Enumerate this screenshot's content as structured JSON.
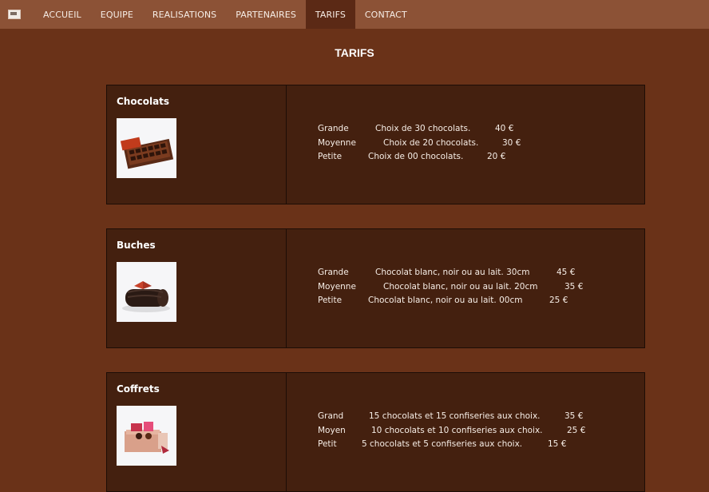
{
  "nav": {
    "items": [
      {
        "label": "ACCUEIL"
      },
      {
        "label": "EQUIPE"
      },
      {
        "label": "REALISATIONS"
      },
      {
        "label": "PARTENAIRES"
      },
      {
        "label": "TARIFS",
        "active": true
      },
      {
        "label": "CONTACT"
      }
    ]
  },
  "page": {
    "title": "TARIFS"
  },
  "sections": [
    {
      "title": "Chocolats",
      "image_icon": "chocolate-box-icon",
      "rows": [
        {
          "size": "Grande",
          "desc": "Choix de 30 chocolats.",
          "price": "40 €"
        },
        {
          "size": "Moyenne",
          "desc": "Choix de 20 chocolats.",
          "price": "30 €"
        },
        {
          "size": "Petite",
          "desc": "Choix de 00 chocolats.",
          "price": "20 €"
        }
      ]
    },
    {
      "title": "Buches",
      "image_icon": "yule-log-icon",
      "rows": [
        {
          "size": "Grande",
          "desc": "Chocolat blanc, noir ou au lait. 30cm",
          "price": "45 €"
        },
        {
          "size": "Moyenne",
          "desc": "Chocolat blanc, noir ou au lait. 20cm",
          "price": "35 €"
        },
        {
          "size": "Petite",
          "desc": "Chocolat blanc, noir ou au lait. 00cm",
          "price": "25 €"
        }
      ]
    },
    {
      "title": "Coffrets",
      "image_icon": "gift-box-icon",
      "rows": [
        {
          "size": "Grand",
          "desc": "15 chocolats et 15 confiseries aux choix.",
          "price": "35 €"
        },
        {
          "size": "Moyen",
          "desc": "10 chocolats et 10 confiseries aux choix.",
          "price": "25 €"
        },
        {
          "size": "Petit",
          "desc": "5 chocolats et 5 confiseries aux choix.",
          "price": "15 €"
        }
      ]
    }
  ],
  "colors": {
    "nav_bg": "#8c5236",
    "nav_active": "#5b2915",
    "page_bg": "#6a3218",
    "card_bg": "#44200f"
  }
}
